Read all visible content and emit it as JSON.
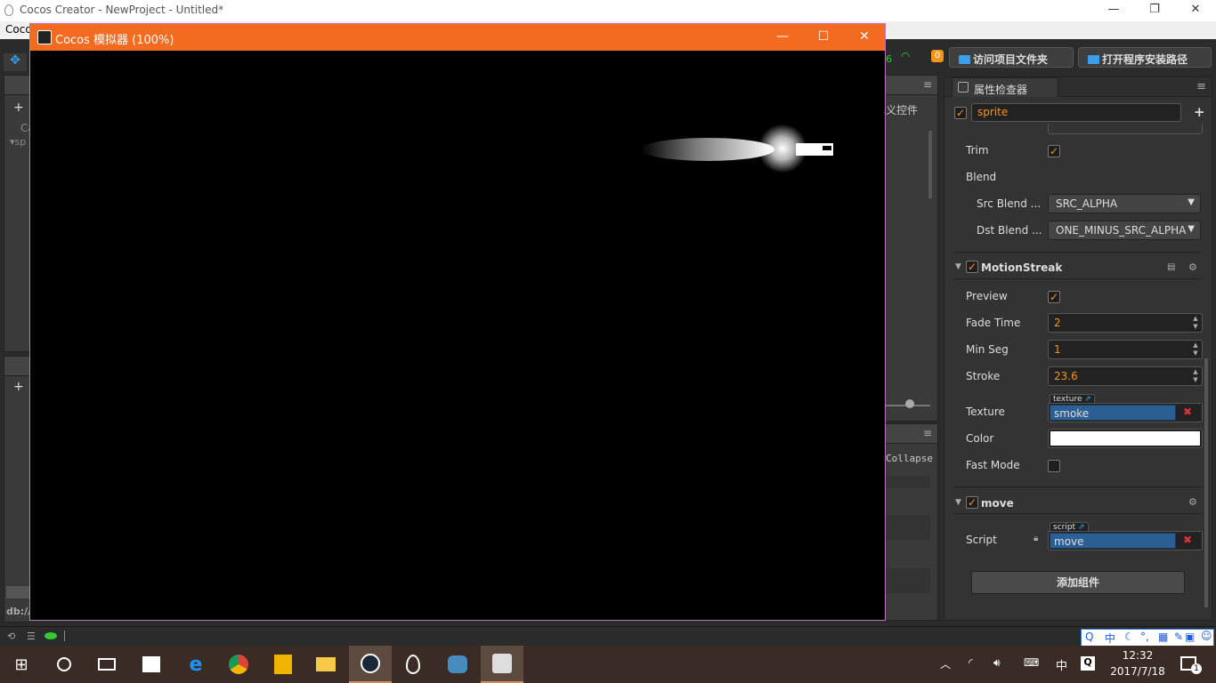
{
  "window": {
    "title": "Cocos Creator - NewProject - Untitled*",
    "minimize": "—",
    "restore": "❐",
    "close": "✕"
  },
  "menubar": {
    "visible_text": "Coco"
  },
  "toolbar": {
    "open_project_folder": "访问项目文件夹",
    "open_install_path": "打开程序安装路径",
    "badge_count": "0",
    "partial_number": "6"
  },
  "left_panels": {
    "hierarchy_partial": "Ca",
    "hierarchy_node_partial": "sp",
    "assets_path_partial": "db://a"
  },
  "middle_panels": {
    "widgets_partial": "义控件",
    "console_collapse": "Collapse"
  },
  "simulator": {
    "title": "Cocos 模拟器 (100%)",
    "minimize": "—",
    "maximize": "☐",
    "close": "✕"
  },
  "inspector": {
    "tab_title": "属性检查器",
    "node_name": "sprite",
    "trim_label": "Trim",
    "trim_checked": true,
    "blend_label": "Blend",
    "src_blend_label": "Src Blend ...",
    "src_blend_value": "SRC_ALPHA",
    "dst_blend_label": "Dst Blend ...",
    "dst_blend_value": "ONE_MINUS_SRC_ALPHA",
    "motion_streak": {
      "title": "MotionStreak",
      "enabled": true,
      "preview_label": "Preview",
      "preview_checked": true,
      "fade_time_label": "Fade Time",
      "fade_time": "2",
      "min_seg_label": "Min Seg",
      "min_seg": "1",
      "stroke_label": "Stroke",
      "stroke": "23.6",
      "texture_label": "Texture",
      "texture_tag": "texture",
      "texture_value": "smoke",
      "color_label": "Color",
      "color_value": "#ffffff",
      "fast_mode_label": "Fast Mode",
      "fast_mode_checked": false
    },
    "move": {
      "title": "move",
      "enabled": true,
      "script_label": "Script",
      "script_tag": "script",
      "script_value": "move"
    },
    "add_component": "添加组件"
  },
  "taskbar": {
    "time": "12:32",
    "date": "2017/7/18",
    "ime": "中",
    "notification_count": "1",
    "ime_toolbar_lang": "中"
  },
  "colors": {
    "accent": "#f7941d",
    "simulator_bar": "#f26b21",
    "asset_blue": "#2c5f93"
  }
}
